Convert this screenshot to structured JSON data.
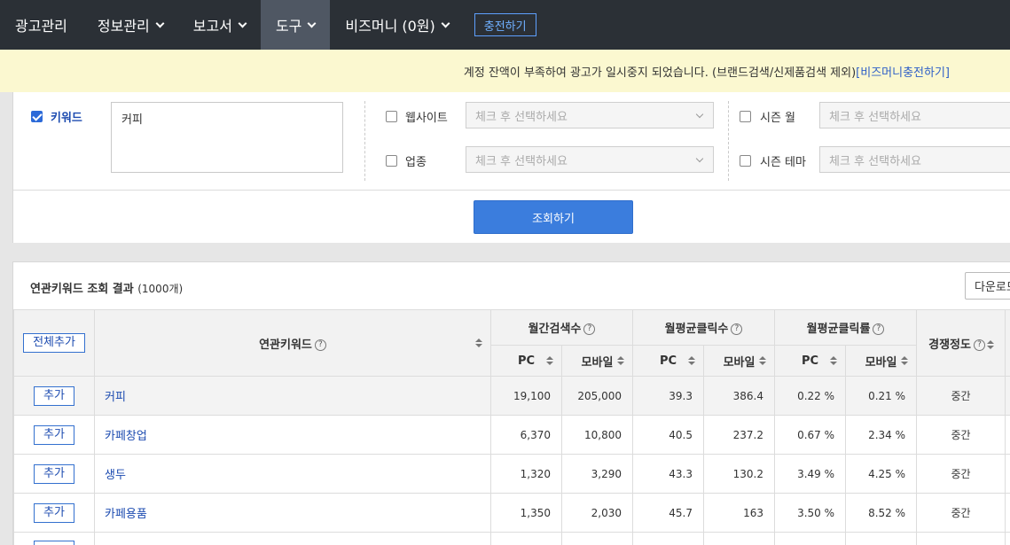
{
  "nav": {
    "items": [
      {
        "label": "광고관리",
        "dropdown": false,
        "active": false
      },
      {
        "label": "정보관리",
        "dropdown": true,
        "active": false
      },
      {
        "label": "보고서",
        "dropdown": true,
        "active": false
      },
      {
        "label": "도구",
        "dropdown": true,
        "active": true
      },
      {
        "label": "비즈머니 (0원)",
        "dropdown": true,
        "active": false
      }
    ],
    "charge_label": "충전하기"
  },
  "notice": {
    "text": "계정 잔액이 부족하여 광고가 일시중지 되었습니다. (브랜드검색/신제품검색 제외)",
    "link": "[비즈머니충전하기]"
  },
  "filter": {
    "keyword_label": "키워드",
    "keyword_value": "커피",
    "website_label": "웹사이트",
    "industry_label": "업종",
    "season_month_label": "시즌 월",
    "season_theme_label": "시즌 테마",
    "select_placeholder": "체크 후 선택하세요",
    "search_label": "조회하기"
  },
  "results": {
    "title": "연관키워드 조회 결과",
    "count": "(1000개)",
    "download_label": "다운로드",
    "add_all_label": "전체추가",
    "headers": {
      "keyword": "연관키워드",
      "monthly_search": "월간검색수",
      "monthly_clicks": "월평균클릭수",
      "monthly_ctr": "월평균클릭률",
      "competition": "경쟁정도",
      "pc": "PC",
      "mobile": "모바일"
    },
    "add_label": "추가",
    "rows": [
      {
        "keyword": "커피",
        "search_pc": "19,100",
        "search_mobile": "205,000",
        "click_pc": "39.3",
        "click_mobile": "386.4",
        "ctr_pc": "0.22 %",
        "ctr_mobile": "0.21 %",
        "competition": "중간"
      },
      {
        "keyword": "카페창업",
        "search_pc": "6,370",
        "search_mobile": "10,800",
        "click_pc": "40.5",
        "click_mobile": "237.2",
        "ctr_pc": "0.67 %",
        "ctr_mobile": "2.34 %",
        "competition": "중간"
      },
      {
        "keyword": "생두",
        "search_pc": "1,320",
        "search_mobile": "3,290",
        "click_pc": "43.3",
        "click_mobile": "130.2",
        "ctr_pc": "3.49 %",
        "ctr_mobile": "4.25 %",
        "competition": "중간"
      },
      {
        "keyword": "카페용품",
        "search_pc": "1,350",
        "search_mobile": "2,030",
        "click_pc": "45.7",
        "click_mobile": "163",
        "ctr_pc": "3.50 %",
        "ctr_mobile": "8.52 %",
        "competition": "중간"
      }
    ]
  }
}
